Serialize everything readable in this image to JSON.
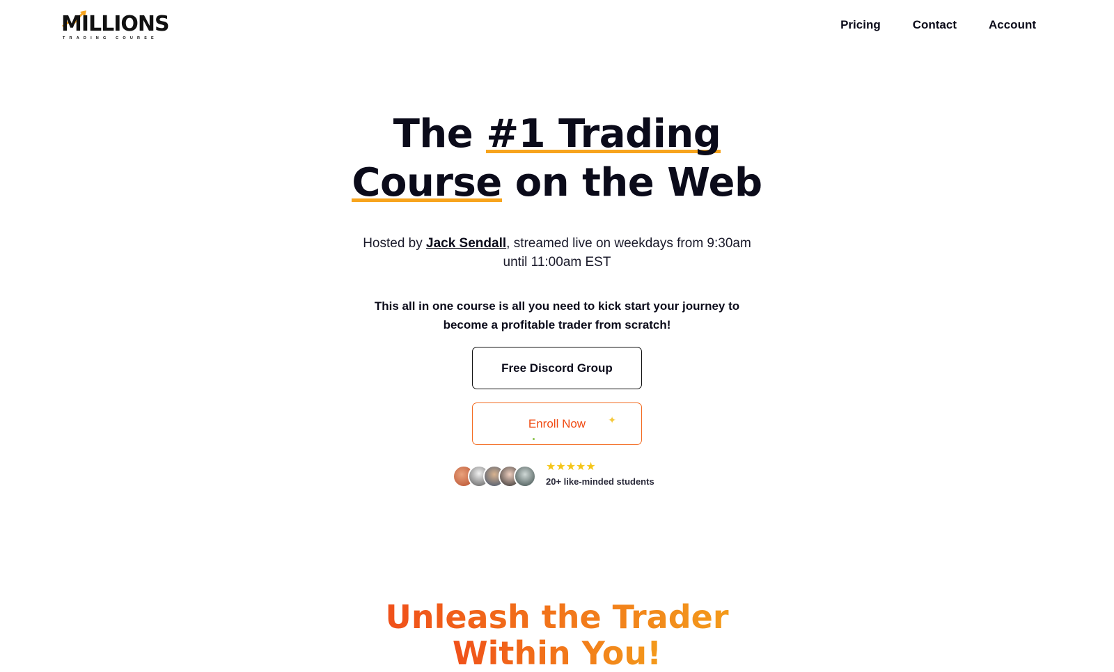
{
  "brand": {
    "logo_text": "MILLIONS",
    "logo_subtext": "TRADING COURSE",
    "accent_color": "#f7a41d",
    "highlight_color": "#f04a12"
  },
  "nav": {
    "items": [
      {
        "label": "Pricing"
      },
      {
        "label": "Contact"
      },
      {
        "label": "Account"
      }
    ]
  },
  "hero": {
    "headline_part1": "The ",
    "headline_highlight1": "#1 Trading",
    "headline_highlight2": "Course",
    "headline_part2": " on the Web",
    "hosted_prefix": "Hosted by ",
    "host_name": "Jack Sendall",
    "hosted_suffix": ", streamed live on weekdays from 9:30am until 11:00am EST",
    "pitch": "This all in one course is all you need to kick start your journey to become a profitable trader from scratch!",
    "discord_button": "Free Discord Group",
    "enroll_button": "Enroll Now",
    "rating_stars": "★★★★★",
    "rating_value": 5,
    "students_text": "20+ like-minded students"
  },
  "section": {
    "title_line1": "Unleash the Trader",
    "title_line2": "Within You!"
  }
}
